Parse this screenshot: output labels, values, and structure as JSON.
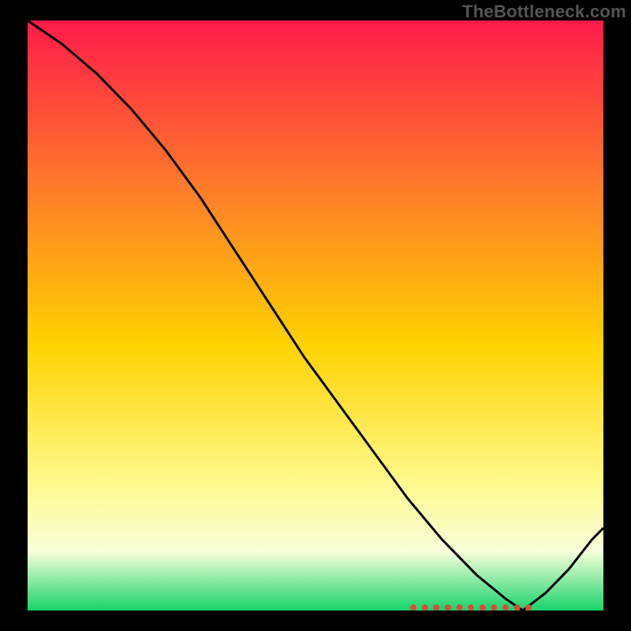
{
  "watermark": "TheBottleneck.com",
  "chart_data": {
    "type": "line",
    "title": "",
    "xlabel": "",
    "ylabel": "",
    "xlim": [
      0,
      100
    ],
    "ylim": [
      0,
      100
    ],
    "axes_visible": false,
    "grid": false,
    "background_gradient": {
      "top": "#ff1a4b",
      "upper_mid": "#ff7a2a",
      "mid": "#ffd200",
      "lower_mid": "#fff98a",
      "band": "#f8ffda",
      "bottom": "#18d36b"
    },
    "series": [
      {
        "name": "curve",
        "color": "#000000",
        "stroke_width": 3,
        "x": [
          0,
          6,
          12,
          18,
          24,
          30,
          36,
          42,
          48,
          54,
          60,
          66,
          72,
          78,
          83,
          86,
          90,
          94,
          98,
          100
        ],
        "y": [
          100,
          96,
          91,
          85,
          78,
          70,
          61,
          52,
          43,
          35,
          27,
          19,
          12,
          6,
          2,
          0,
          3,
          7,
          12,
          14
        ]
      }
    ],
    "markers": [
      {
        "name": "dot-strip",
        "shape": "circle",
        "color": "#d84a3a",
        "radius": 4,
        "y": 0.5,
        "x": [
          67,
          69,
          71,
          73,
          75,
          77,
          79,
          81,
          83,
          85,
          87
        ]
      }
    ]
  }
}
